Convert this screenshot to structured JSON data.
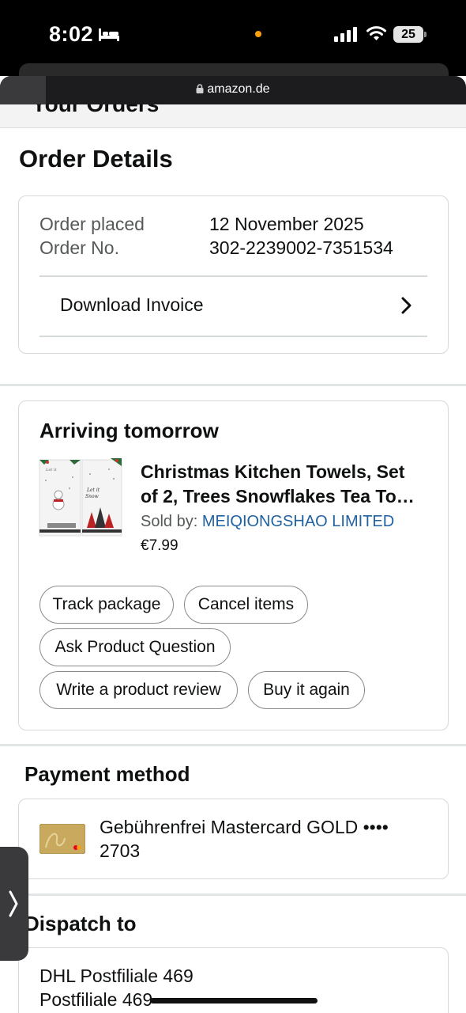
{
  "status_bar": {
    "time": "8:02",
    "battery": "25",
    "icons": [
      "bed-icon",
      "signal-icon",
      "wifi-icon",
      "battery-icon"
    ]
  },
  "browser": {
    "url": "amazon.de",
    "icons": [
      "lock-icon"
    ]
  },
  "page": {
    "prev_title": "Your Orders",
    "title": "Order Details"
  },
  "order": {
    "placed_label": "Order placed",
    "placed_value": "12 November 2025",
    "number_label": "Order No.",
    "number_value": "302-2239002-7351534",
    "invoice_label": "Download Invoice"
  },
  "shipment": {
    "status": "Arriving tomorrow",
    "product": {
      "title_line1": "Christmas Kitchen Towels, Set",
      "title_line2": "of 2, Trees Snowflakes Tea To…",
      "sold_by_label": "Sold by: ",
      "seller": "MEIQIONGSHAO LIMITED",
      "price": "€7.99",
      "image_texts": [
        "Let it",
        "Snow"
      ]
    },
    "actions": {
      "track": "Track package",
      "cancel": "Cancel items",
      "ask": "Ask Product Question",
      "review": "Write a product review",
      "buy_again": "Buy it again"
    }
  },
  "payment": {
    "heading": "Payment method",
    "card_line1": "Gebührenfrei Mastercard GOLD ••••",
    "card_line2": "2703"
  },
  "dispatch": {
    "heading": "Dispatch to",
    "line1": "DHL Postfiliale 469",
    "line2": "Postfiliale 469"
  },
  "colors": {
    "link": "#2162a1",
    "border": "#d5d9d9",
    "text": "#0f1111",
    "muted": "#565959",
    "accent_dot": "#ff9f0a"
  }
}
